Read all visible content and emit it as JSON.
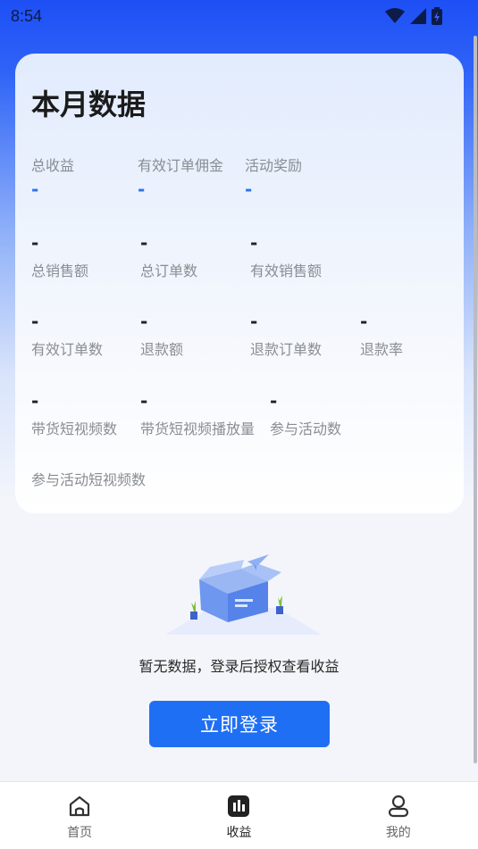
{
  "status_bar": {
    "time": "8:54"
  },
  "card": {
    "title": "本月数据",
    "row1": [
      {
        "label": "总收益",
        "value": "-"
      },
      {
        "label": "有效订单佣金",
        "value": "-"
      },
      {
        "label": "活动奖励",
        "value": "-"
      }
    ],
    "row2": [
      {
        "label": "总销售额",
        "value": "-"
      },
      {
        "label": "总订单数",
        "value": "-"
      },
      {
        "label": "有效销售额",
        "value": "-"
      }
    ],
    "row3": [
      {
        "label": "有效订单数",
        "value": "-"
      },
      {
        "label": "退款额",
        "value": "-"
      },
      {
        "label": "退款订单数",
        "value": "-"
      },
      {
        "label": "退款率",
        "value": "-"
      }
    ],
    "row4": [
      {
        "label": "带货短视频数",
        "value": "-"
      },
      {
        "label": "带货短视频播放量",
        "value": "-"
      },
      {
        "label": "参与活动数",
        "value": "-"
      }
    ],
    "row5": [
      {
        "label": "参与活动短视频数"
      }
    ]
  },
  "empty_state": {
    "message": "暂无数据，登录后授权查看收益",
    "login_label": "立即登录"
  },
  "bottom_nav": {
    "items": [
      {
        "label": "首页",
        "icon": "home-icon",
        "active": false
      },
      {
        "label": "收益",
        "icon": "earnings-icon",
        "active": true
      },
      {
        "label": "我的",
        "icon": "profile-icon",
        "active": false
      }
    ]
  },
  "colors": {
    "accent": "#1f6ff4",
    "highlight_value": "#2c74e8"
  }
}
